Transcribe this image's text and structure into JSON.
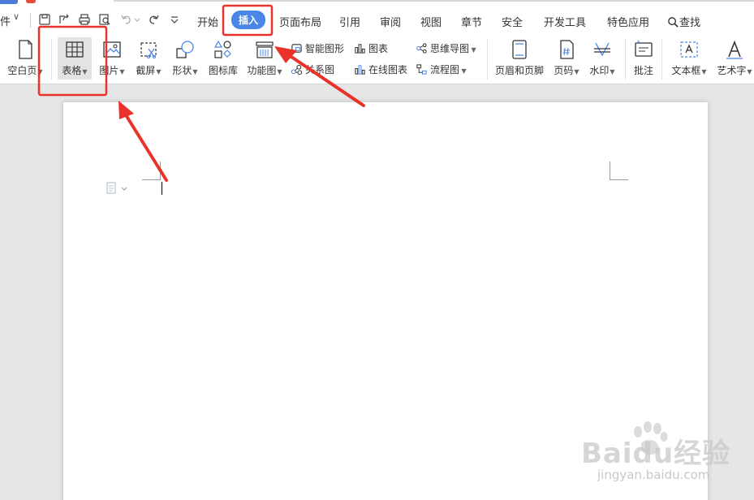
{
  "menu": {
    "file_label": "件",
    "file_caret": "∨",
    "tabs": [
      "开始",
      "插入",
      "页面布局",
      "引用",
      "审阅",
      "视图",
      "章节",
      "安全",
      "开发工具",
      "特色应用"
    ],
    "active_tab": "插入",
    "search_label": "查找"
  },
  "ribbon": {
    "blank_page": "空白页",
    "table": "表格",
    "picture": "图片",
    "screenshot": "截屏",
    "shape": "形状",
    "icon_library": "图标库",
    "function_chart": "功能图",
    "smart_graphic": "智能图形",
    "chart": "图表",
    "mind_map": "思维导图",
    "relationship": "关系图",
    "online_chart": "在线图表",
    "flowchart": "流程图",
    "header_footer": "页眉和页脚",
    "page_number": "页码",
    "watermark": "水印",
    "comment": "批注",
    "text_box": "文本框",
    "word_art": "艺术字"
  },
  "colors": {
    "accent": "#4a86e8",
    "annotation": "#e8322a",
    "canvas": "#e6e6e6"
  },
  "watermark": {
    "brand": "Baidu",
    "brand_cn": "经验",
    "url": "jingyan.baidu.com"
  }
}
